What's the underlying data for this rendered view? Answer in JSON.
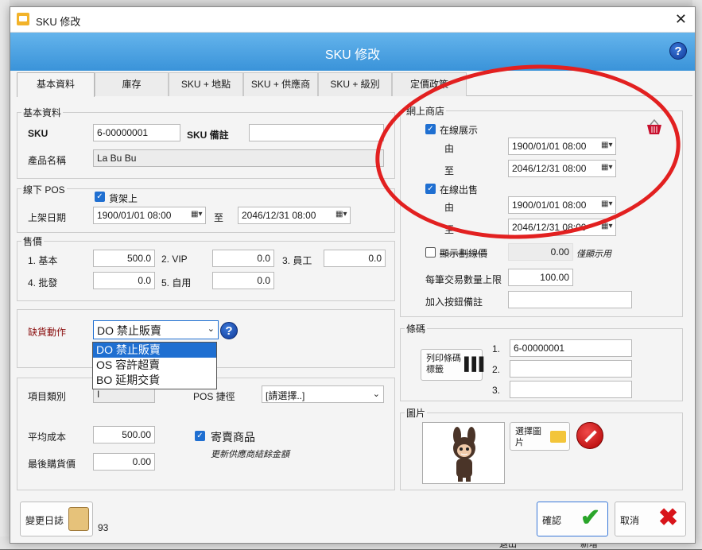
{
  "window": {
    "title": "SKU 修改",
    "banner_title": "SKU 修改"
  },
  "tabs": [
    "基本資料",
    "庫存",
    "SKU + 地點",
    "SKU + 供應商",
    "SKU + 級別",
    "定價政策"
  ],
  "basic": {
    "group_label": "基本資料",
    "sku_label": "SKU",
    "sku_value": "6-00000001",
    "sku_note_label": "SKU 備註",
    "sku_note_value": "",
    "name_label": "產品名稱",
    "name_value": "La Bu Bu"
  },
  "offline": {
    "group_label": "線下 POS",
    "on_shelf_label": "貨架上",
    "date_label": "上架日期",
    "from_value": "1900/01/01 08:00",
    "to_label": "至",
    "to_value": "2046/12/31 08:00"
  },
  "price": {
    "group_label": "售價",
    "rows": [
      {
        "label": "1. 基本",
        "value": "500.0"
      },
      {
        "label": "2. VIP",
        "value": "0.0"
      },
      {
        "label": "3. 員工",
        "value": "0.0"
      },
      {
        "label": "4. 批發",
        "value": "0.0"
      },
      {
        "label": "5. 自用",
        "value": "0.0"
      }
    ]
  },
  "stockout": {
    "label": "缺貨動作",
    "selected": "DO 禁止販賣",
    "options": [
      "DO 禁止販賣",
      "OS 容許超賣",
      "BO 延期交貨"
    ]
  },
  "item": {
    "category_label": "項目類別",
    "category_value": "I",
    "pos_label": "POS 捷徑",
    "pos_value": "[請選擇..]",
    "avg_cost_label": "平均成本",
    "avg_cost_value": "500.00",
    "last_cost_label": "最後購貨價",
    "last_cost_value": "0.00",
    "consign_label": "寄賣商品",
    "consign_note": "更新供應商結餘金額"
  },
  "online": {
    "group_label": "網上商店",
    "display_label": "在線展示",
    "display_from_label": "由",
    "display_from": "1900/01/01 08:00",
    "display_to_label": "至",
    "display_to": "2046/12/31 08:00",
    "sell_label": "在線出售",
    "sell_from_label": "由",
    "sell_from": "1900/01/01 08:00",
    "sell_to_label": "至",
    "sell_to": "2046/12/31 08:00",
    "strike_label": "顯示劃線價",
    "strike_value": "0.00",
    "strike_note": "僅顯示用",
    "max_qty_label": "每筆交易數量上限",
    "max_qty_value": "100.00",
    "cart_note_label": "加入按鈕備註",
    "cart_note_value": ""
  },
  "barcode": {
    "group_label": "條碼",
    "print_label": "列印條碼標籤",
    "rows": [
      {
        "n": "1.",
        "v": "6-00000001"
      },
      {
        "n": "2.",
        "v": ""
      },
      {
        "n": "3.",
        "v": ""
      }
    ]
  },
  "image": {
    "group_label": "圖片",
    "choose_label": "選擇圖片"
  },
  "footer": {
    "log_label": "變更日誌",
    "count": "93",
    "ok_label": "確認",
    "cancel_label": "取消"
  },
  "background": {
    "bottom_left": "退出",
    "bottom_right": "新增"
  },
  "colors": {
    "banner": "#3a93d9",
    "checkbox": "#1f6fd1",
    "annotation": "#e22020"
  }
}
